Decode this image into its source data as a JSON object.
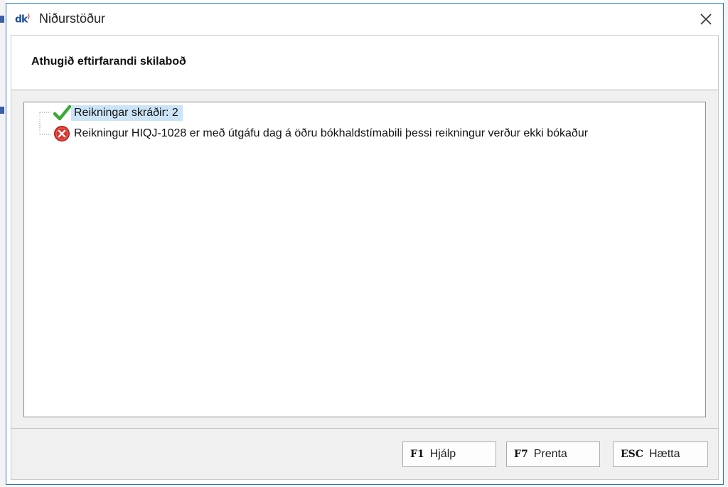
{
  "window": {
    "title": "Niðurstöður",
    "app_icon_text": "dk",
    "close_glyph": "✕"
  },
  "header": {
    "title": "Athugið eftirfarandi skilaboð"
  },
  "messages": [
    {
      "icon": "check-icon",
      "text": "Reikningar skráðir: 2",
      "selected": true
    },
    {
      "icon": "error-icon",
      "text": "Reikningur HIQJ-1028 er með útgáfu dag á öðru bókhaldstímabili þessi reikningur verður ekki bókaður",
      "selected": false
    }
  ],
  "buttons": [
    {
      "key": "F1",
      "label": "Hjálp"
    },
    {
      "key": "F7",
      "label": "Prenta"
    },
    {
      "key": "ESC",
      "label": "Hætta"
    }
  ],
  "colors": {
    "window_border": "#2b78c8",
    "selection": "#cce4f7",
    "success": "#3aa935",
    "error": "#d9342b"
  }
}
